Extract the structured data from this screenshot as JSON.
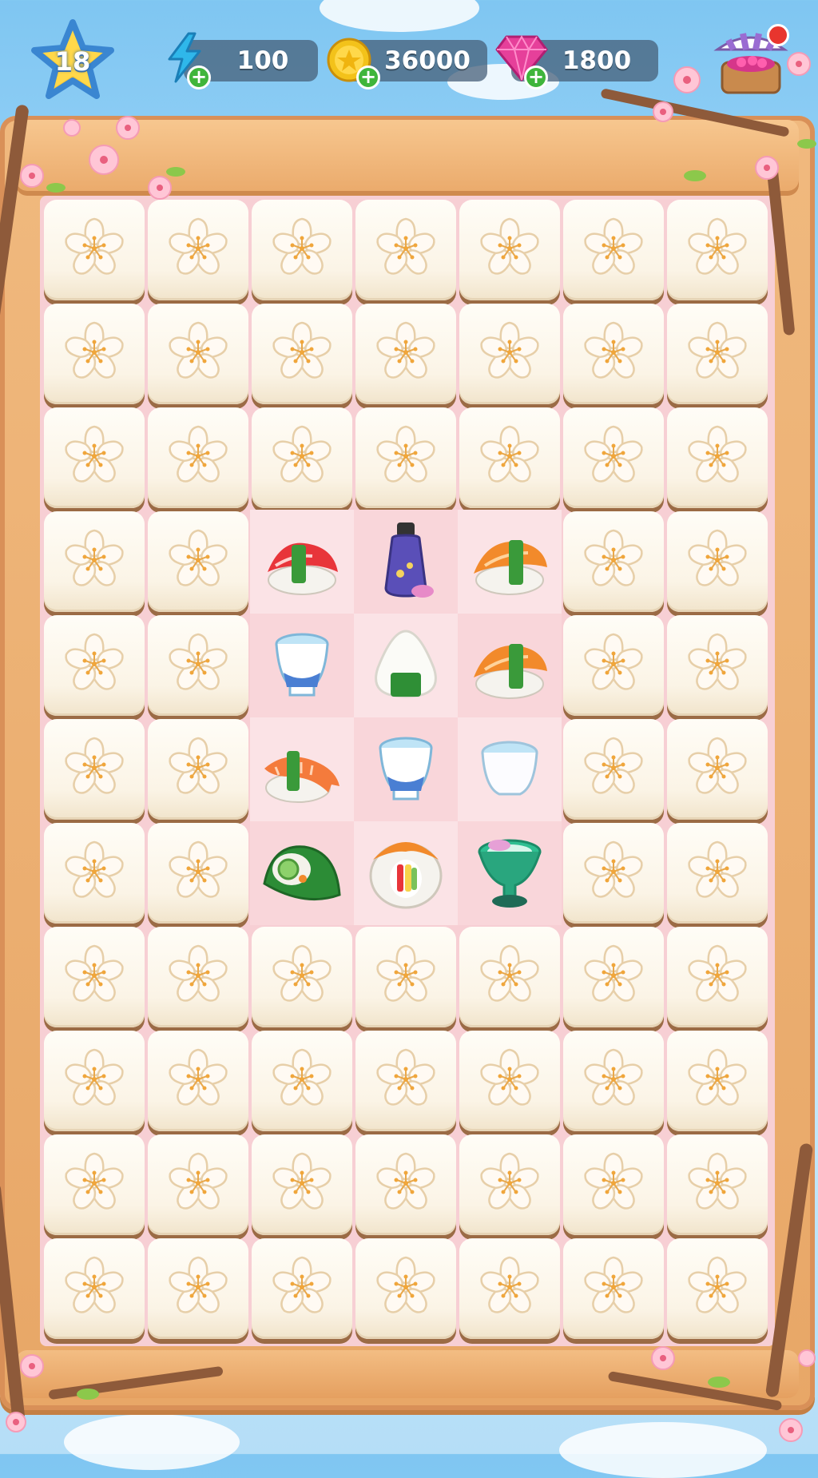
{
  "hud": {
    "level": "18",
    "energy": {
      "value": "100",
      "icon": "lightning-icon",
      "color": "#2fb7ea"
    },
    "coins": {
      "value": "36000",
      "icon": "gold-coin-icon",
      "color": "#f3c21a"
    },
    "gems": {
      "value": "1800",
      "icon": "pink-gem-icon",
      "color": "#e6409a"
    },
    "shop": {
      "icon": "shop-stall-icon",
      "has_notification": true
    }
  },
  "board": {
    "columns": 7,
    "rows": 11,
    "covered_tile_icon": "cherry-blossom-icon",
    "revealed_items": [
      {
        "row": 3,
        "col": 2,
        "item": "tuna-nigiri"
      },
      {
        "row": 3,
        "col": 3,
        "item": "soy-sauce-bottle"
      },
      {
        "row": 3,
        "col": 4,
        "item": "salmon-nigiri"
      },
      {
        "row": 4,
        "col": 2,
        "item": "sake-cup"
      },
      {
        "row": 4,
        "col": 3,
        "item": "onigiri"
      },
      {
        "row": 4,
        "col": 4,
        "item": "salmon-nigiri"
      },
      {
        "row": 5,
        "col": 2,
        "item": "shrimp-nigiri"
      },
      {
        "row": 5,
        "col": 3,
        "item": "sake-cup"
      },
      {
        "row": 5,
        "col": 4,
        "item": "white-sake-cup"
      },
      {
        "row": 6,
        "col": 2,
        "item": "cucumber-temaki"
      },
      {
        "row": 6,
        "col": 3,
        "item": "california-roll"
      },
      {
        "row": 6,
        "col": 4,
        "item": "matcha-cup"
      }
    ]
  },
  "colors": {
    "board_pink": "#f7cfd4",
    "frame_wood": "#eaa96a",
    "tile_cream": "#fbf4e6"
  }
}
